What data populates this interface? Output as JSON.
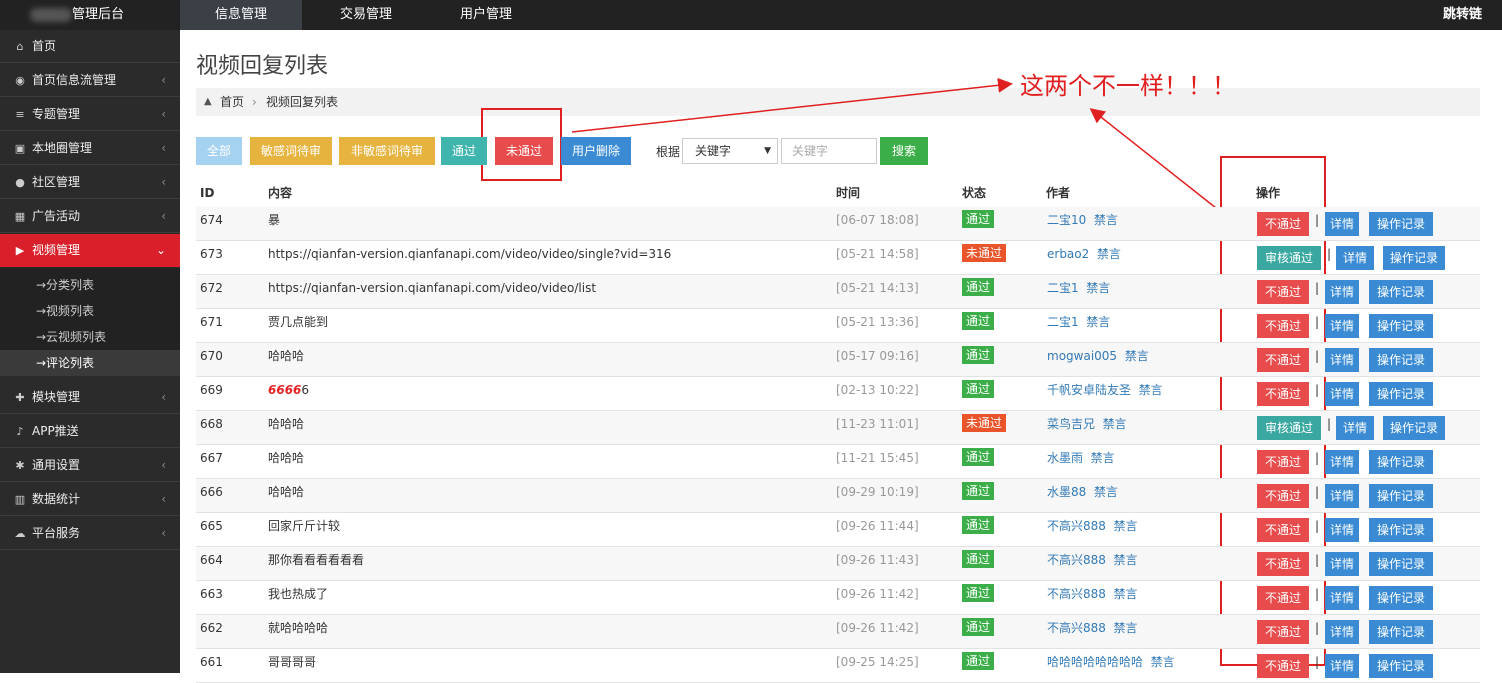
{
  "header": {
    "brand": "管理后台",
    "nav": [
      "信息管理",
      "交易管理",
      "用户管理"
    ],
    "right_link": "跳转链"
  },
  "sidebar": {
    "items": [
      {
        "icon": "home-icon",
        "label": "首页",
        "chevron": false
      },
      {
        "icon": "rss-icon",
        "label": "首页信息流管理",
        "chevron": true
      },
      {
        "icon": "list-icon",
        "label": "专题管理",
        "chevron": true
      },
      {
        "icon": "image-icon",
        "label": "本地圈管理",
        "chevron": true
      },
      {
        "icon": "users-icon",
        "label": "社区管理",
        "chevron": true
      },
      {
        "icon": "calendar-icon",
        "label": "广告活动",
        "chevron": true
      },
      {
        "icon": "video-icon",
        "label": "视频管理",
        "chevron": true
      }
    ],
    "sub_items": [
      "→分类列表",
      "→视频列表",
      "→云视频列表",
      "→评论列表"
    ],
    "items_after": [
      {
        "icon": "puzzle-icon",
        "label": "模块管理",
        "chevron": true
      },
      {
        "icon": "bell-icon",
        "label": "APP推送",
        "chevron": false
      },
      {
        "icon": "gears-icon",
        "label": "通用设置",
        "chevron": true
      },
      {
        "icon": "bar-chart-icon",
        "label": "数据统计",
        "chevron": true
      },
      {
        "icon": "cloud-icon",
        "label": "平台服务",
        "chevron": true
      }
    ],
    "chevron_left": "‹",
    "chevron_down": "⌄"
  },
  "page": {
    "title": "视频回复列表",
    "breadcrumb": {
      "home": "首页",
      "sep": "›",
      "current": "视频回复列表"
    }
  },
  "filters": {
    "buttons": [
      {
        "label": "全部",
        "color": "#a6d2f2"
      },
      {
        "label": "敏感词待审",
        "color": "#e6b33e"
      },
      {
        "label": "非敏感词待审",
        "color": "#e6b33e"
      },
      {
        "label": "通过",
        "color": "#3fb5ad"
      },
      {
        "label": "未通过",
        "color": "#e84b4b"
      },
      {
        "label": "用户删除",
        "color": "#3a8bd4"
      }
    ],
    "search_by_label": "根据",
    "select_value": "关键字",
    "select_arrow": "▼",
    "input_placeholder": "关键字",
    "search_button": "搜索"
  },
  "table": {
    "headers": {
      "id": "ID",
      "content": "内容",
      "time": "时间",
      "status": "状态",
      "author": "作者",
      "actions": "操作"
    },
    "ban_label": "禁言",
    "pipe": "|",
    "actions": {
      "reject": "不通过",
      "approve": "审核通过",
      "detail": "详情",
      "log": "操作记录"
    },
    "rows": [
      {
        "id": "674",
        "content": "暴",
        "time": "[06-07 18:08]",
        "status": "通过",
        "author": "二宝10"
      },
      {
        "id": "673",
        "content": "https://qianfan-version.qianfanapi.com/video/video/single?vid=316",
        "time": "[05-21 14:58]",
        "status": "未通过",
        "author": "erbao2"
      },
      {
        "id": "672",
        "content": "https://qianfan-version.qianfanapi.com/video/video/list",
        "time": "[05-21 14:13]",
        "status": "通过",
        "author": "二宝1"
      },
      {
        "id": "671",
        "content": "贾几点能到",
        "time": "[05-21 13:36]",
        "status": "通过",
        "author": "二宝1"
      },
      {
        "id": "670",
        "content": "哈哈哈",
        "time": "[05-17 09:16]",
        "status": "通过",
        "author": "mogwai005"
      },
      {
        "id": "669",
        "content": "6666",
        "content_suffix": "6",
        "time": "[02-13 10:22]",
        "status": "通过",
        "author": "千帆安卓陆友圣"
      },
      {
        "id": "668",
        "content": "哈哈哈",
        "time": "[11-23 11:01]",
        "status": "未通过",
        "author": "菜鸟吉兄"
      },
      {
        "id": "667",
        "content": "哈哈哈",
        "time": "[11-21 15:45]",
        "status": "通过",
        "author": "水墨雨"
      },
      {
        "id": "666",
        "content": "哈哈哈",
        "time": "[09-29 10:19]",
        "status": "通过",
        "author": "水墨88"
      },
      {
        "id": "665",
        "content": "回家斤斤计较",
        "time": "[09-26 11:44]",
        "status": "通过",
        "author": "不高兴888"
      },
      {
        "id": "664",
        "content": "那你看看看看看看",
        "time": "[09-26 11:43]",
        "status": "通过",
        "author": "不高兴888"
      },
      {
        "id": "663",
        "content": "我也热成了",
        "time": "[09-26 11:42]",
        "status": "通过",
        "author": "不高兴888"
      },
      {
        "id": "662",
        "content": "就哈哈哈哈",
        "time": "[09-26 11:42]",
        "status": "通过",
        "author": "不高兴888"
      },
      {
        "id": "661",
        "content": "哥哥哥哥",
        "time": "[09-25 14:25]",
        "status": "通过",
        "author": "哈哈哈哈哈哈哈哈"
      }
    ]
  },
  "annotation": {
    "text": "这两个不一样！！！",
    "color": "#e02020"
  }
}
